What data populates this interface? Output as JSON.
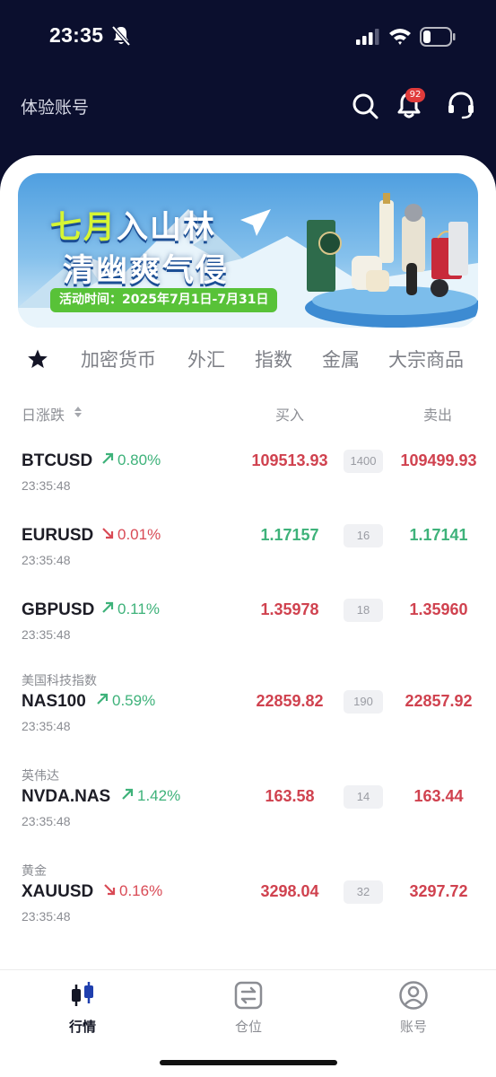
{
  "status_bar": {
    "time": "23:35"
  },
  "header": {
    "title": "体验账号",
    "notification_count": "92"
  },
  "banner": {
    "title_highlight": "七月",
    "title_rest": "入山林",
    "subtitle": "清幽爽气侵",
    "date_text": "活动时间：2025年7月1日-7月31日"
  },
  "tabs": [
    "加密货币",
    "外汇",
    "指数",
    "金属",
    "大宗商品"
  ],
  "table_header": {
    "change": "日涨跌",
    "buy": "买入",
    "sell": "卖出"
  },
  "quotes": [
    {
      "subtitle": "",
      "symbol": "BTCUSD",
      "direction": "up",
      "change": "0.80%",
      "time": "23:35:48",
      "buy": "109513.93",
      "spread": "1400",
      "sell": "109499.93",
      "price_color": "red"
    },
    {
      "subtitle": "",
      "symbol": "EURUSD",
      "direction": "down",
      "change": "0.01%",
      "time": "23:35:48",
      "buy": "1.17157",
      "spread": "16",
      "sell": "1.17141",
      "price_color": "green"
    },
    {
      "subtitle": "",
      "symbol": "GBPUSD",
      "direction": "up",
      "change": "0.11%",
      "time": "23:35:48",
      "buy": "1.35978",
      "spread": "18",
      "sell": "1.35960",
      "price_color": "red"
    },
    {
      "subtitle": "美国科技指数",
      "symbol": "NAS100",
      "direction": "up",
      "change": "0.59%",
      "time": "23:35:48",
      "buy": "22859.82",
      "spread": "190",
      "sell": "22857.92",
      "price_color": "red"
    },
    {
      "subtitle": "英伟达",
      "symbol": "NVDA.NAS",
      "direction": "up",
      "change": "1.42%",
      "time": "23:35:48",
      "buy": "163.58",
      "spread": "14",
      "sell": "163.44",
      "price_color": "red"
    },
    {
      "subtitle": "黄金",
      "symbol": "XAUUSD",
      "direction": "down",
      "change": "0.16%",
      "time": "23:35:48",
      "buy": "3298.04",
      "spread": "32",
      "sell": "3297.72",
      "price_color": "red"
    }
  ],
  "bottom_nav": [
    {
      "label": "行情",
      "icon": "candlestick-icon",
      "active": true
    },
    {
      "label": "仓位",
      "icon": "transfer-icon",
      "active": false
    },
    {
      "label": "账号",
      "icon": "user-icon",
      "active": false
    }
  ],
  "colors": {
    "up": "#3eb27a",
    "down": "#d94a55",
    "price_red": "#d0424f",
    "price_green": "#3eb27a",
    "header_bg": "#0b0f2e"
  }
}
